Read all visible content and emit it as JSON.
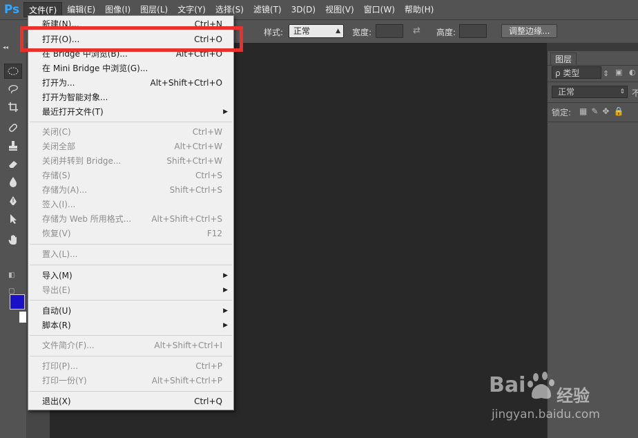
{
  "app": {
    "logo": "Ps"
  },
  "menubar": [
    {
      "label": "文件(F)",
      "active": true
    },
    {
      "label": "编辑(E)"
    },
    {
      "label": "图像(I)"
    },
    {
      "label": "图层(L)"
    },
    {
      "label": "文字(Y)"
    },
    {
      "label": "选择(S)"
    },
    {
      "label": "滤镜(T)"
    },
    {
      "label": "3D(D)"
    },
    {
      "label": "视图(V)"
    },
    {
      "label": "窗口(W)"
    },
    {
      "label": "帮助(H)"
    }
  ],
  "options": {
    "style_label": "样式:",
    "style_value": "正常",
    "width_label": "宽度:",
    "height_label": "高度:",
    "refine_edge": "调整边缘..."
  },
  "file_menu": {
    "items": [
      {
        "label": "新建(N)...",
        "shortcut": "Ctrl+N"
      },
      {
        "label": "打开(O)...",
        "shortcut": "Ctrl+O"
      },
      {
        "label": "在 Bridge 中浏览(B)...",
        "shortcut": "Alt+Ctrl+O"
      },
      {
        "label": "在 Mini Bridge 中浏览(G)...",
        "shortcut": ""
      },
      {
        "label": "打开为...",
        "shortcut": "Alt+Shift+Ctrl+O"
      },
      {
        "label": "打开为智能对象...",
        "shortcut": ""
      },
      {
        "label": "最近打开文件(T)",
        "shortcut": "",
        "submenu": true
      },
      {
        "label": "关闭(C)",
        "shortcut": "Ctrl+W",
        "disabled": true
      },
      {
        "label": "关闭全部",
        "shortcut": "Alt+Ctrl+W",
        "disabled": true
      },
      {
        "label": "关闭并转到 Bridge...",
        "shortcut": "Shift+Ctrl+W",
        "disabled": true
      },
      {
        "label": "存储(S)",
        "shortcut": "Ctrl+S",
        "disabled": true
      },
      {
        "label": "存储为(A)...",
        "shortcut": "Shift+Ctrl+S",
        "disabled": true
      },
      {
        "label": "签入(I)...",
        "shortcut": "",
        "disabled": true
      },
      {
        "label": "存储为 Web 所用格式...",
        "shortcut": "Alt+Shift+Ctrl+S",
        "disabled": true
      },
      {
        "label": "恢复(V)",
        "shortcut": "F12",
        "disabled": true
      },
      {
        "label": "置入(L)...",
        "shortcut": "",
        "disabled": true
      },
      {
        "label": "导入(M)",
        "shortcut": "",
        "submenu": true
      },
      {
        "label": "导出(E)",
        "shortcut": "",
        "submenu": true,
        "disabled": true
      },
      {
        "label": "自动(U)",
        "shortcut": "",
        "submenu": true
      },
      {
        "label": "脚本(R)",
        "shortcut": "",
        "submenu": true
      },
      {
        "label": "文件简介(F)...",
        "shortcut": "Alt+Shift+Ctrl+I",
        "disabled": true
      },
      {
        "label": "打印(P)...",
        "shortcut": "Ctrl+P",
        "disabled": true
      },
      {
        "label": "打印一份(Y)",
        "shortcut": "Alt+Shift+Ctrl+P",
        "disabled": true
      },
      {
        "label": "退出(X)",
        "shortcut": "Ctrl+Q"
      }
    ]
  },
  "layers_panel": {
    "tab": "图层",
    "filter": "ρ 类型",
    "blend_mode": "正常",
    "lock_label": "锁定:",
    "opacity_cut": "不"
  },
  "icons": {
    "tools": [
      "marquee-icon",
      "lasso-icon",
      "crop-icon",
      "healing-icon",
      "stamp-icon",
      "eraser-icon",
      "blur-icon",
      "pen-icon",
      "selection-arrow-icon",
      "hand-icon"
    ]
  },
  "colors": {
    "foreground": "#1a10c8",
    "highlight": "#e8312d"
  },
  "watermark": {
    "brand": "Bai",
    "brand_suffix": "经验",
    "url": "jingyan.baidu.com"
  }
}
